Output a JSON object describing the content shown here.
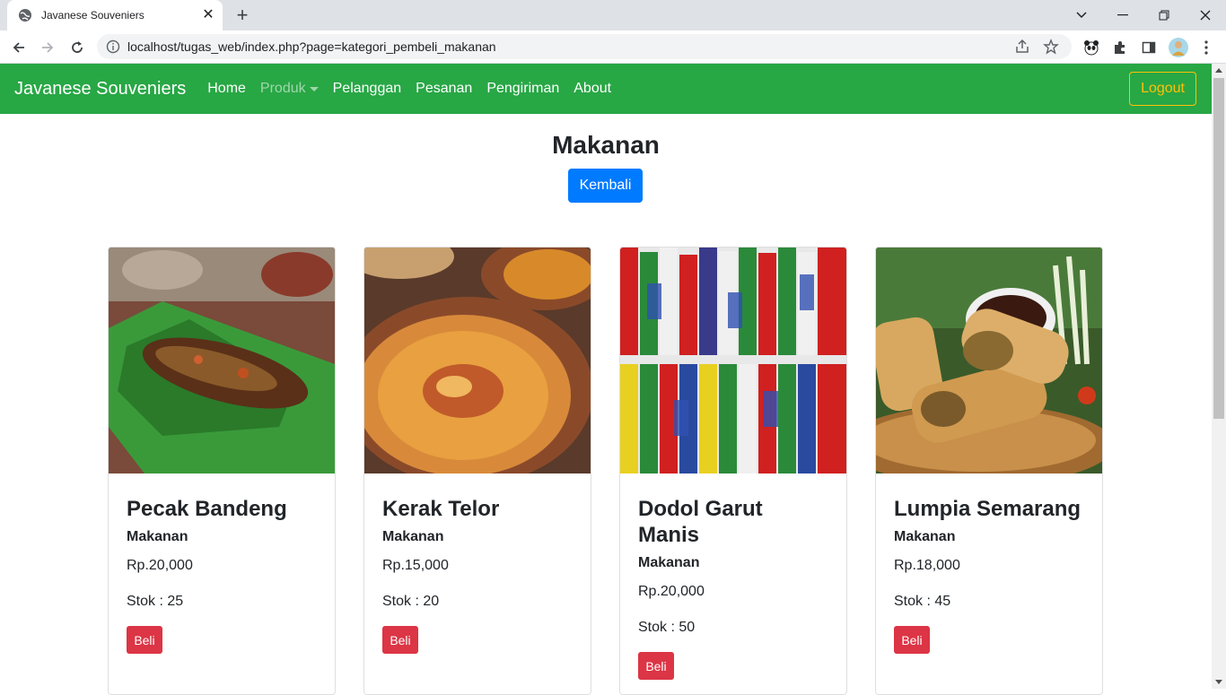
{
  "browser": {
    "tab_title": "Javanese Souveniers",
    "url": "localhost/tugas_web/index.php?page=kategori_pembeli_makanan"
  },
  "navbar": {
    "brand": "Javanese Souveniers",
    "links": [
      "Home",
      "Produk",
      "Pelanggan",
      "Pesanan",
      "Pengiriman",
      "About"
    ],
    "logout": "Logout",
    "colors": {
      "bg": "#28a745",
      "logout": "#ffc107"
    }
  },
  "page": {
    "title": "Makanan",
    "back_button": "Kembali"
  },
  "products": [
    {
      "name": "Pecak Bandeng",
      "category": "Makanan",
      "price": "Rp.20,000",
      "stock": "Stok : 25",
      "buy": "Beli"
    },
    {
      "name": "Kerak Telor",
      "category": "Makanan",
      "price": "Rp.15,000",
      "stock": "Stok : 20",
      "buy": "Beli"
    },
    {
      "name": "Dodol Garut Manis",
      "category": "Makanan",
      "price": "Rp.20,000",
      "stock": "Stok : 50",
      "buy": "Beli"
    },
    {
      "name": "Lumpia Semarang",
      "category": "Makanan",
      "price": "Rp.18,000",
      "stock": "Stok : 45",
      "buy": "Beli"
    }
  ],
  "icons": [
    "globe-icon",
    "close-icon",
    "plus-icon",
    "back-arrow-icon",
    "forward-arrow-icon",
    "reload-icon",
    "info-icon",
    "share-icon",
    "star-icon",
    "panda-extension-icon",
    "puzzle-icon",
    "side-panel-icon",
    "avatar",
    "kebab-menu-icon"
  ]
}
